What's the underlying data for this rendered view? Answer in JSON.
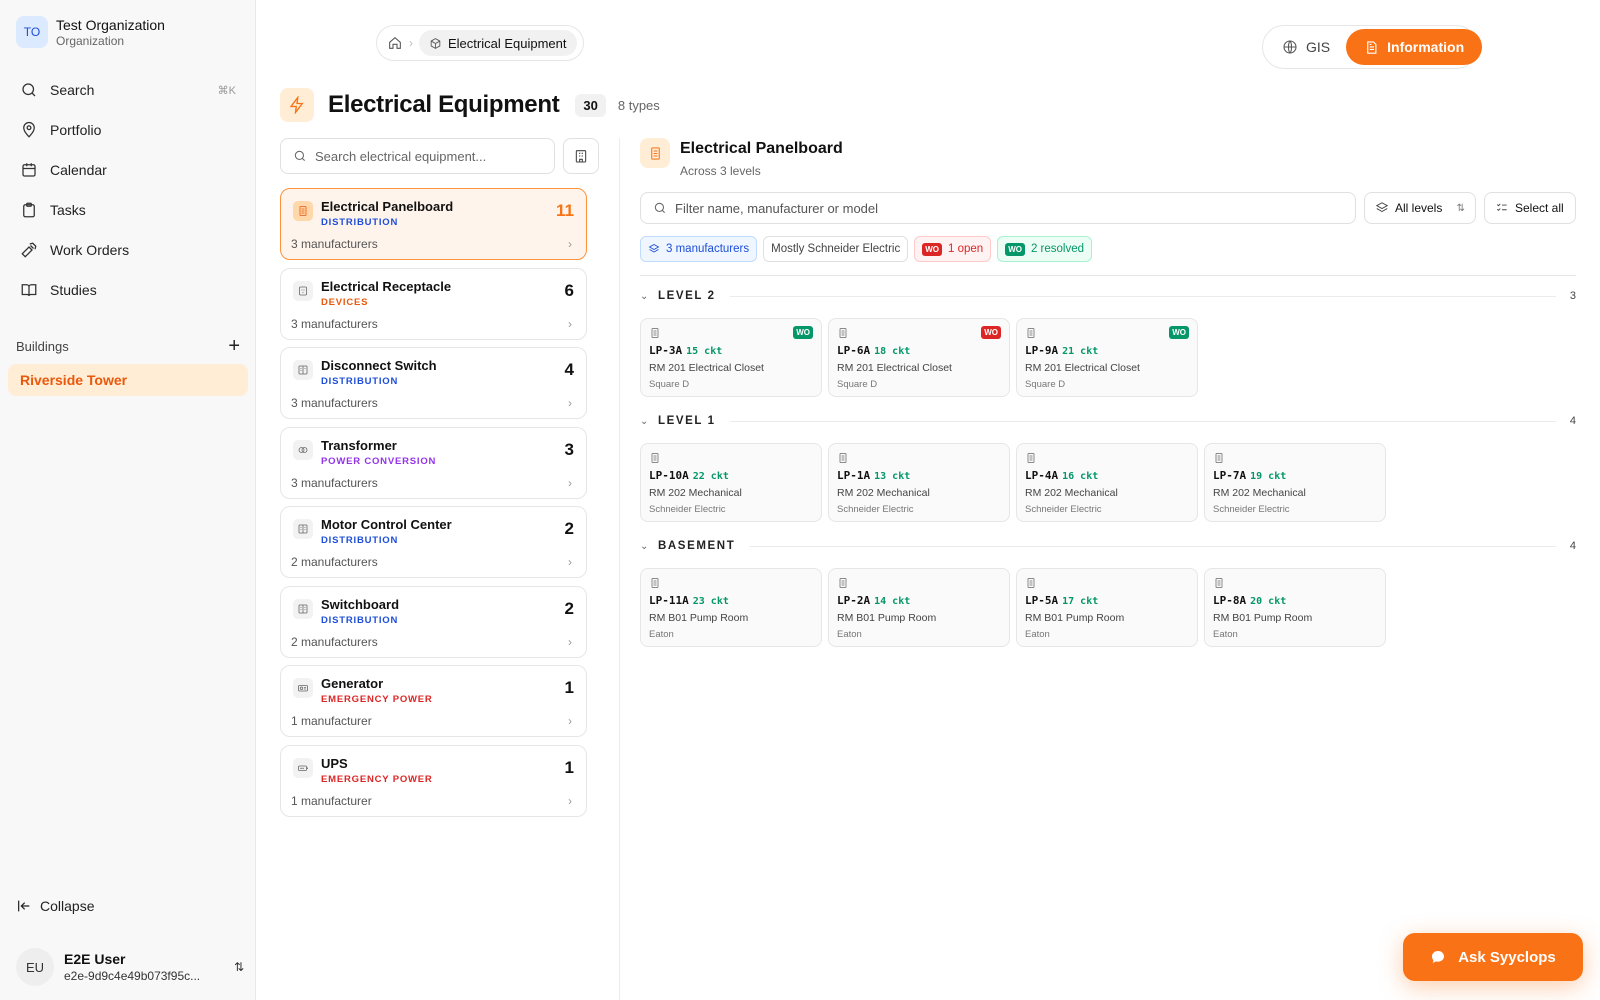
{
  "org": {
    "initials": "TO",
    "name": "Test Organization",
    "type": "Organization"
  },
  "nav": [
    {
      "label": "Search",
      "icon": "search-icon",
      "shortcut": "⌘K"
    },
    {
      "label": "Portfolio",
      "icon": "map-pin-icon"
    },
    {
      "label": "Calendar",
      "icon": "calendar-icon"
    },
    {
      "label": "Tasks",
      "icon": "clipboard-icon"
    },
    {
      "label": "Work Orders",
      "icon": "hammer-icon"
    },
    {
      "label": "Studies",
      "icon": "book-icon"
    }
  ],
  "buildings": {
    "heading": "Buildings",
    "add_label": "+",
    "items": [
      "Riverside Tower"
    ]
  },
  "collapse_label": "Collapse",
  "user": {
    "initials": "EU",
    "name": "E2E User",
    "email": "e2e-9d9c4e49b073f95c..."
  },
  "breadcrumb": {
    "current": "Electrical Equipment"
  },
  "view_toggle": {
    "gis": "GIS",
    "information": "Information",
    "active": "information"
  },
  "page": {
    "title": "Electrical Equipment",
    "count": "30",
    "types": "8 types"
  },
  "search": {
    "placeholder": "Search electrical equipment..."
  },
  "equipment_types": [
    {
      "name": "Electrical Panelboard",
      "category": "DISTRIBUTION",
      "category_color": "#1d4ed8",
      "count": "11",
      "manufacturers": "3 manufacturers",
      "active": true,
      "icon": "panel-icon"
    },
    {
      "name": "Electrical Receptacle",
      "category": "DEVICES",
      "category_color": "#ea580c",
      "count": "6",
      "manufacturers": "3 manufacturers",
      "icon": "outlet-icon"
    },
    {
      "name": "Disconnect Switch",
      "category": "DISTRIBUTION",
      "category_color": "#1d4ed8",
      "count": "4",
      "manufacturers": "3 manufacturers",
      "icon": "switch-icon"
    },
    {
      "name": "Transformer",
      "category": "POWER CONVERSION",
      "category_color": "#9333ea",
      "count": "3",
      "manufacturers": "3 manufacturers",
      "icon": "transformer-icon"
    },
    {
      "name": "Motor Control Center",
      "category": "DISTRIBUTION",
      "category_color": "#1d4ed8",
      "count": "2",
      "manufacturers": "2 manufacturers",
      "icon": "mcc-icon"
    },
    {
      "name": "Switchboard",
      "category": "DISTRIBUTION",
      "category_color": "#1d4ed8",
      "count": "2",
      "manufacturers": "2 manufacturers",
      "icon": "switchboard-icon"
    },
    {
      "name": "Generator",
      "category": "EMERGENCY POWER",
      "category_color": "#dc2626",
      "count": "1",
      "manufacturers": "1 manufacturer",
      "icon": "generator-icon"
    },
    {
      "name": "UPS",
      "category": "EMERGENCY POWER",
      "category_color": "#dc2626",
      "count": "1",
      "manufacturers": "1 manufacturer",
      "icon": "battery-icon"
    }
  ],
  "detail": {
    "title": "Electrical Panelboard",
    "subtitle": "Across 3 levels",
    "filter_placeholder": "Filter name, manufacturer or model",
    "levels_label": "All levels",
    "select_all_label": "Select all",
    "chips": {
      "manufacturers": "3 manufacturers",
      "mostly": "Mostly Schneider Electric",
      "wo_tag": "WO",
      "open": "1 open",
      "resolved": "2 resolved"
    },
    "levels": [
      {
        "name": "LEVEL 2",
        "count": "3",
        "items": [
          {
            "name": "LP-3A",
            "ckt": "15 ckt",
            "room": "RM 201 Electrical Closet",
            "mfr": "Square D",
            "wo": "green"
          },
          {
            "name": "LP-6A",
            "ckt": "18 ckt",
            "room": "RM 201 Electrical Closet",
            "mfr": "Square D",
            "wo": "red"
          },
          {
            "name": "LP-9A",
            "ckt": "21 ckt",
            "room": "RM 201 Electrical Closet",
            "mfr": "Square D",
            "wo": "green"
          }
        ]
      },
      {
        "name": "LEVEL 1",
        "count": "4",
        "items": [
          {
            "name": "LP-10A",
            "ckt": "22 ckt",
            "room": "RM 202 Mechanical",
            "mfr": "Schneider Electric"
          },
          {
            "name": "LP-1A",
            "ckt": "13 ckt",
            "room": "RM 202 Mechanical",
            "mfr": "Schneider Electric"
          },
          {
            "name": "LP-4A",
            "ckt": "16 ckt",
            "room": "RM 202 Mechanical",
            "mfr": "Schneider Electric"
          },
          {
            "name": "LP-7A",
            "ckt": "19 ckt",
            "room": "RM 202 Mechanical",
            "mfr": "Schneider Electric"
          }
        ]
      },
      {
        "name": "BASEMENT",
        "count": "4",
        "items": [
          {
            "name": "LP-11A",
            "ckt": "23 ckt",
            "room": "RM B01 Pump Room",
            "mfr": "Eaton"
          },
          {
            "name": "LP-2A",
            "ckt": "14 ckt",
            "room": "RM B01 Pump Room",
            "mfr": "Eaton"
          },
          {
            "name": "LP-5A",
            "ckt": "17 ckt",
            "room": "RM B01 Pump Room",
            "mfr": "Eaton"
          },
          {
            "name": "LP-8A",
            "ckt": "20 ckt",
            "room": "RM B01 Pump Room",
            "mfr": "Eaton"
          }
        ]
      }
    ]
  },
  "ask_button": "Ask Syyclops",
  "colors": {
    "accent": "#f97316",
    "active_bg": "#fff4ec",
    "wo_red": "#dc2626",
    "wo_green": "#059669"
  }
}
